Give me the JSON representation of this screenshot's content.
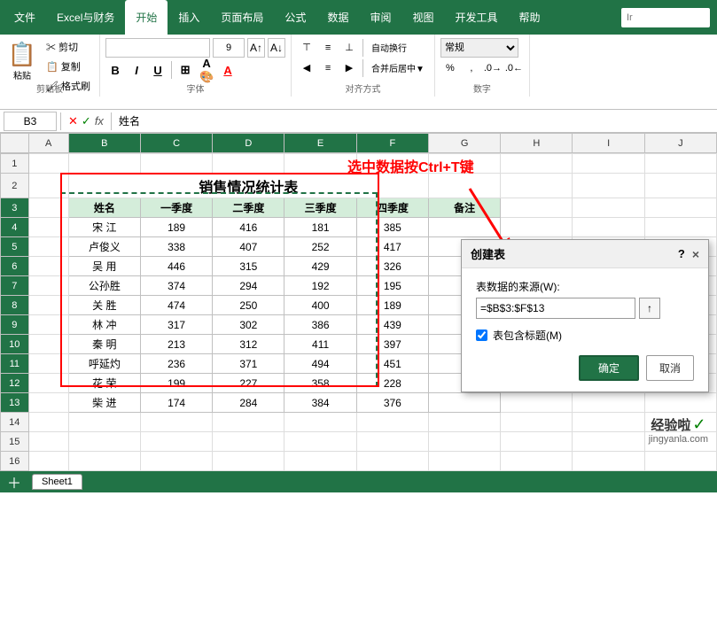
{
  "ribbon": {
    "tabs": [
      "文件",
      "Excel与财务",
      "开始",
      "插入",
      "页面布局",
      "公式",
      "数据",
      "审阅",
      "视图",
      "开发工具",
      "帮助"
    ],
    "active_tab": "开始",
    "search_placeholder": "Ir",
    "clipboard": {
      "paste_label": "粘贴",
      "cut_label": "✂ 剪切",
      "copy_label": "📋 复制",
      "format_label": "🖌 格式刷"
    },
    "font": {
      "name": "",
      "size": "9",
      "bold": "B",
      "italic": "I",
      "underline": "U"
    },
    "alignment": {
      "auto_wrap": "自动换行",
      "merge": "合并后居中▼"
    },
    "number": {
      "format": "常规"
    }
  },
  "formula_bar": {
    "cell_ref": "B3",
    "formula": "姓名"
  },
  "columns": [
    "A",
    "B",
    "C",
    "D",
    "E",
    "F",
    "G",
    "H",
    "I",
    "J"
  ],
  "rows": [
    "1",
    "2",
    "3",
    "4",
    "5",
    "6",
    "7",
    "8",
    "9",
    "10",
    "11",
    "12",
    "13",
    "14",
    "15",
    "16"
  ],
  "sheet": {
    "title": "销售情况统计表",
    "headers": [
      "姓名",
      "一季度",
      "二季度",
      "三季度",
      "四季度",
      "备注"
    ],
    "data": [
      [
        "宋 江",
        "189",
        "416",
        "181",
        "385",
        ""
      ],
      [
        "卢俊义",
        "338",
        "407",
        "252",
        "417",
        ""
      ],
      [
        "吴 用",
        "446",
        "315",
        "429",
        "326",
        ""
      ],
      [
        "公孙胜",
        "374",
        "294",
        "192",
        "195",
        ""
      ],
      [
        "关 胜",
        "474",
        "250",
        "400",
        "189",
        ""
      ],
      [
        "林 冲",
        "317",
        "302",
        "386",
        "439",
        ""
      ],
      [
        "秦 明",
        "213",
        "312",
        "411",
        "397",
        ""
      ],
      [
        "呼延灼",
        "236",
        "371",
        "494",
        "451",
        ""
      ],
      [
        "花 荣",
        "199",
        "227",
        "358",
        "228",
        ""
      ],
      [
        "柴 进",
        "174",
        "284",
        "384",
        "376",
        ""
      ]
    ]
  },
  "annotation": {
    "text": "选中数据按Ctrl+T键"
  },
  "dialog": {
    "title": "创建表",
    "question_mark": "?",
    "close_icon": "×",
    "source_label": "表数据的来源(W):",
    "source_value": "=$B$3:$F$13",
    "upload_icon": "↑",
    "checkbox_label": "表包含标题(M)",
    "confirm_label": "确定",
    "cancel_label": "取消"
  },
  "sheet_tabs": [
    "Sheet1"
  ],
  "watermark": {
    "text": "经验啦",
    "check": "✓",
    "url": "jingyanla.com"
  }
}
